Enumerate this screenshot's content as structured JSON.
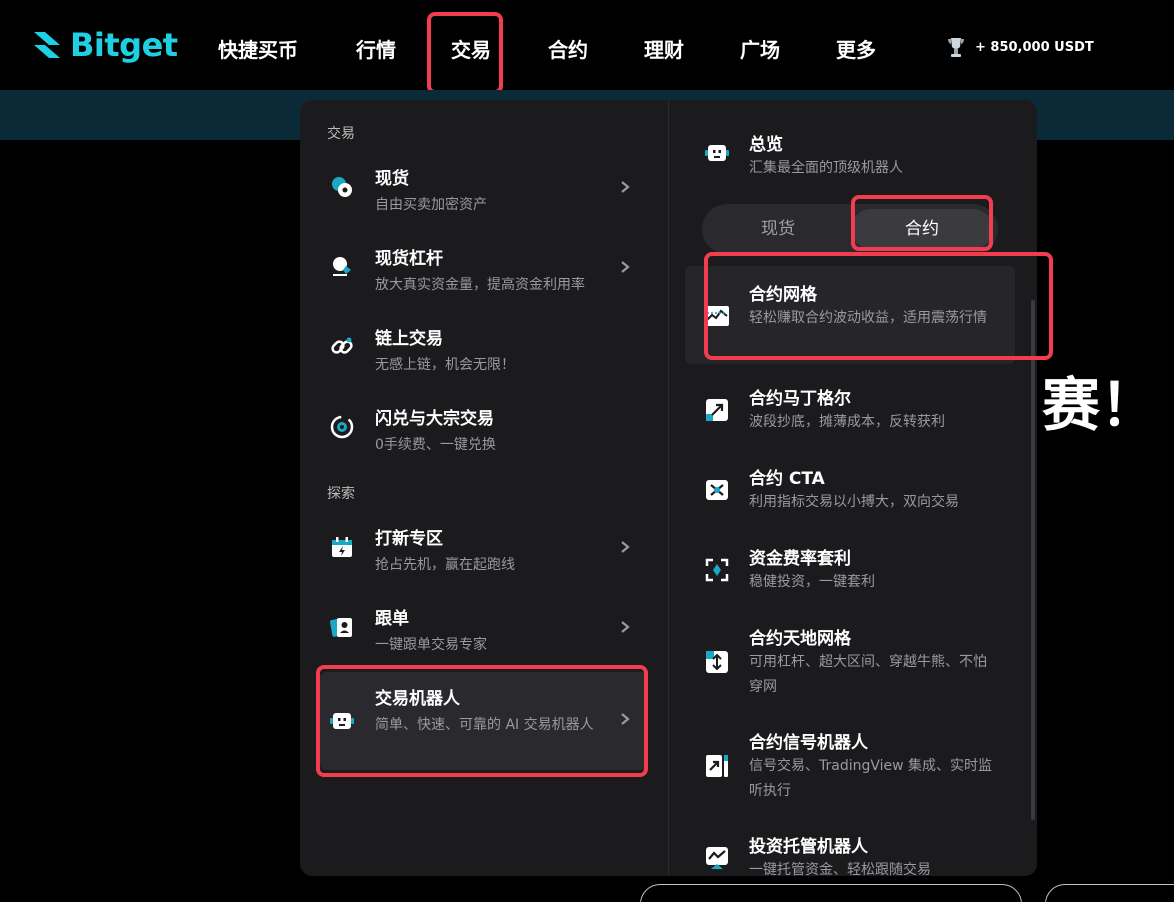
{
  "brand": "Bitget",
  "nav": [
    "快捷买币",
    "行情",
    "交易",
    "合约",
    "理财",
    "广场",
    "更多"
  ],
  "reward": "+ 850,000 USDT",
  "background_text": "赛！",
  "menu": {
    "left": {
      "section_trade": "交易",
      "section_explore": "探索",
      "items": [
        {
          "title": "现货",
          "desc": "自由买卖加密资产",
          "icon": "spot-coins-icon"
        },
        {
          "title": "现货杠杆",
          "desc": "放大真实资金量，提高资金利用率",
          "icon": "margin-icon"
        },
        {
          "title": "链上交易",
          "desc": "无感上链，机会无限！",
          "icon": "chain-link-icon"
        },
        {
          "title": "闪兑与大宗交易",
          "desc": "0手续费、一键兑换",
          "icon": "swap-icon"
        },
        {
          "title": "打新专区",
          "desc": "抢占先机，赢在起跑线",
          "icon": "calendar-bolt-icon"
        },
        {
          "title": "跟单",
          "desc": "一键跟单交易专家",
          "icon": "copy-trade-icon"
        },
        {
          "title": "交易机器人",
          "desc": "简单、快速、可靠的 AI 交易机器人",
          "icon": "robot-icon"
        }
      ]
    },
    "right": {
      "overview": {
        "title": "总览",
        "desc": "汇集最全面的顶级机器人"
      },
      "tabs": [
        "现货",
        "合约"
      ],
      "active_tab": "合约",
      "items": [
        {
          "title": "合约网格",
          "desc": "轻松赚取合约波动收益，适用震荡行情",
          "icon": "grid-chart-icon"
        },
        {
          "title": "合约马丁格尔",
          "desc": "波段抄底，摊薄成本，反转获利",
          "icon": "martingale-icon"
        },
        {
          "title": "合约 CTA",
          "desc": "利用指标交易以小搏大，双向交易",
          "icon": "cta-icon"
        },
        {
          "title": "资金费率套利",
          "desc": "稳健投资，一键套利",
          "icon": "funding-arbitrage-icon"
        },
        {
          "title": "合约天地网格",
          "desc": "可用杠杆、超大区间、穿越牛熊、不怕穿网",
          "icon": "infinity-grid-icon"
        },
        {
          "title": "合约信号机器人",
          "desc": "信号交易、TradingView 集成、实时监听执行",
          "icon": "signal-bot-icon"
        },
        {
          "title": "投资托管机器人",
          "desc": "一键托管资金、轻松跟随交易",
          "icon": "managed-bot-icon"
        }
      ]
    }
  },
  "colors": {
    "brand": "#1ed1e2",
    "highlight": "#f23d4f",
    "panel": "#1b1b1e"
  }
}
